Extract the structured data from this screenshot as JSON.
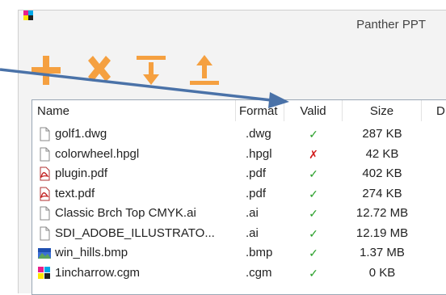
{
  "window": {
    "title": "Panther PPT"
  },
  "toolbar": {
    "buttons": [
      {
        "name": "add-button",
        "icon": "plus-icon"
      },
      {
        "name": "remove-button",
        "icon": "x-icon"
      },
      {
        "name": "move-down-button",
        "icon": "arrow-down-to-line-icon"
      },
      {
        "name": "move-up-button",
        "icon": "arrow-up-from-line-icon"
      }
    ]
  },
  "colors": {
    "accent": "#f5a040",
    "arrow": "#4a72a8",
    "valid": "#2aa02a",
    "invalid": "#d21b1b"
  },
  "columns": {
    "name": "Name",
    "format": "Format",
    "valid": "Valid",
    "size": "Size",
    "date": "D"
  },
  "files": [
    {
      "name": "golf1.dwg",
      "format": ".dwg",
      "valid": "✓",
      "size": "287 KB",
      "icon": "generic-file-icon"
    },
    {
      "name": "colorwheel.hpgl",
      "format": ".hpgl",
      "valid": "✗",
      "size": "42 KB",
      "icon": "generic-file-icon"
    },
    {
      "name": "plugin.pdf",
      "format": ".pdf",
      "valid": "✓",
      "size": "402 KB",
      "icon": "pdf-icon"
    },
    {
      "name": "text.pdf",
      "format": ".pdf",
      "valid": "✓",
      "size": "274 KB",
      "icon": "pdf-icon"
    },
    {
      "name": "Classic Brch Top CMYK.ai",
      "format": ".ai",
      "valid": "✓",
      "size": "12.72 MB",
      "icon": "generic-file-icon"
    },
    {
      "name": "SDI_ADOBE_ILLUSTRATO...",
      "format": ".ai",
      "valid": "✓",
      "size": "12.19 MB",
      "icon": "generic-file-icon"
    },
    {
      "name": "win_hills.bmp",
      "format": ".bmp",
      "valid": "✓",
      "size": "1.37 MB",
      "icon": "image-file-icon"
    },
    {
      "name": "1incharrow.cgm",
      "format": ".cgm",
      "valid": "✓",
      "size": "0 KB",
      "icon": "cgm-file-icon"
    }
  ]
}
